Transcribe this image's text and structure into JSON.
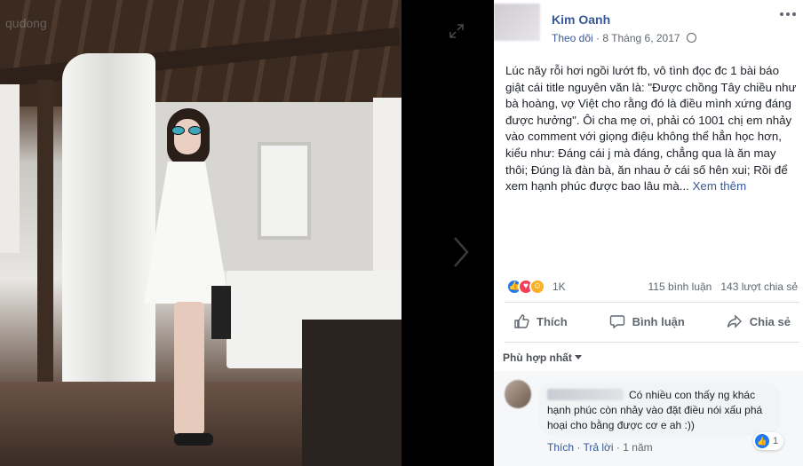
{
  "viewer": {
    "watermark": "qudong",
    "expand_icon": "expand-icon",
    "next_icon": "chevron-right-icon"
  },
  "post": {
    "author": "Kim Oanh",
    "follow_label": "Theo dõi",
    "separator": "·",
    "date": "8 Tháng 6, 2017",
    "privacy_icon": "globe-icon",
    "more_icon": "more-options-icon",
    "text": "Lúc nãy rỗi hơi ngồi lướt fb, vô tình đọc đc 1 bài báo giật cái title nguyên văn là: \"Được chồng Tây chiều như bà hoàng, vợ Việt cho rằng đó là điều mình xứng đáng được hưởng\". Ôi cha mẹ ơi, phải có 1001 chị em nhảy vào comment với giọng điệu không thể hẳn học hơn, kiểu như: Đáng cái j mà đáng, chẳng qua là ăn may thôi; Đúng là đàn bà, ăn nhau ở cái số hên xui; Rồi để xem hạnh phúc được bao lâu mà...",
    "see_more": "Xem thêm"
  },
  "reactions": {
    "count": "1K",
    "comments": "115 bình luận",
    "shares": "143 lượt chia sẻ",
    "icons": [
      "like-icon",
      "love-icon",
      "haha-icon"
    ]
  },
  "actions": {
    "like": "Thích",
    "comment": "Bình luận",
    "share": "Chia sẻ"
  },
  "comments": {
    "filter_label": "Phù hợp nhất",
    "items": [
      {
        "text": "Có nhiều con thấy ng khác hạnh phúc còn nhảy vào đặt điều nói xấu phá hoại cho bằng được cơ e ah :))",
        "like_count": "1",
        "like_action": "Thích",
        "dot": "·",
        "reply_action": "Trả lời",
        "time": "1 năm"
      }
    ]
  },
  "colors": {
    "link": "#385898",
    "secondary_text": "#606770",
    "like_blue": "#2078f4",
    "love_red": "#f33e58",
    "haha_yellow": "#f7b125"
  }
}
